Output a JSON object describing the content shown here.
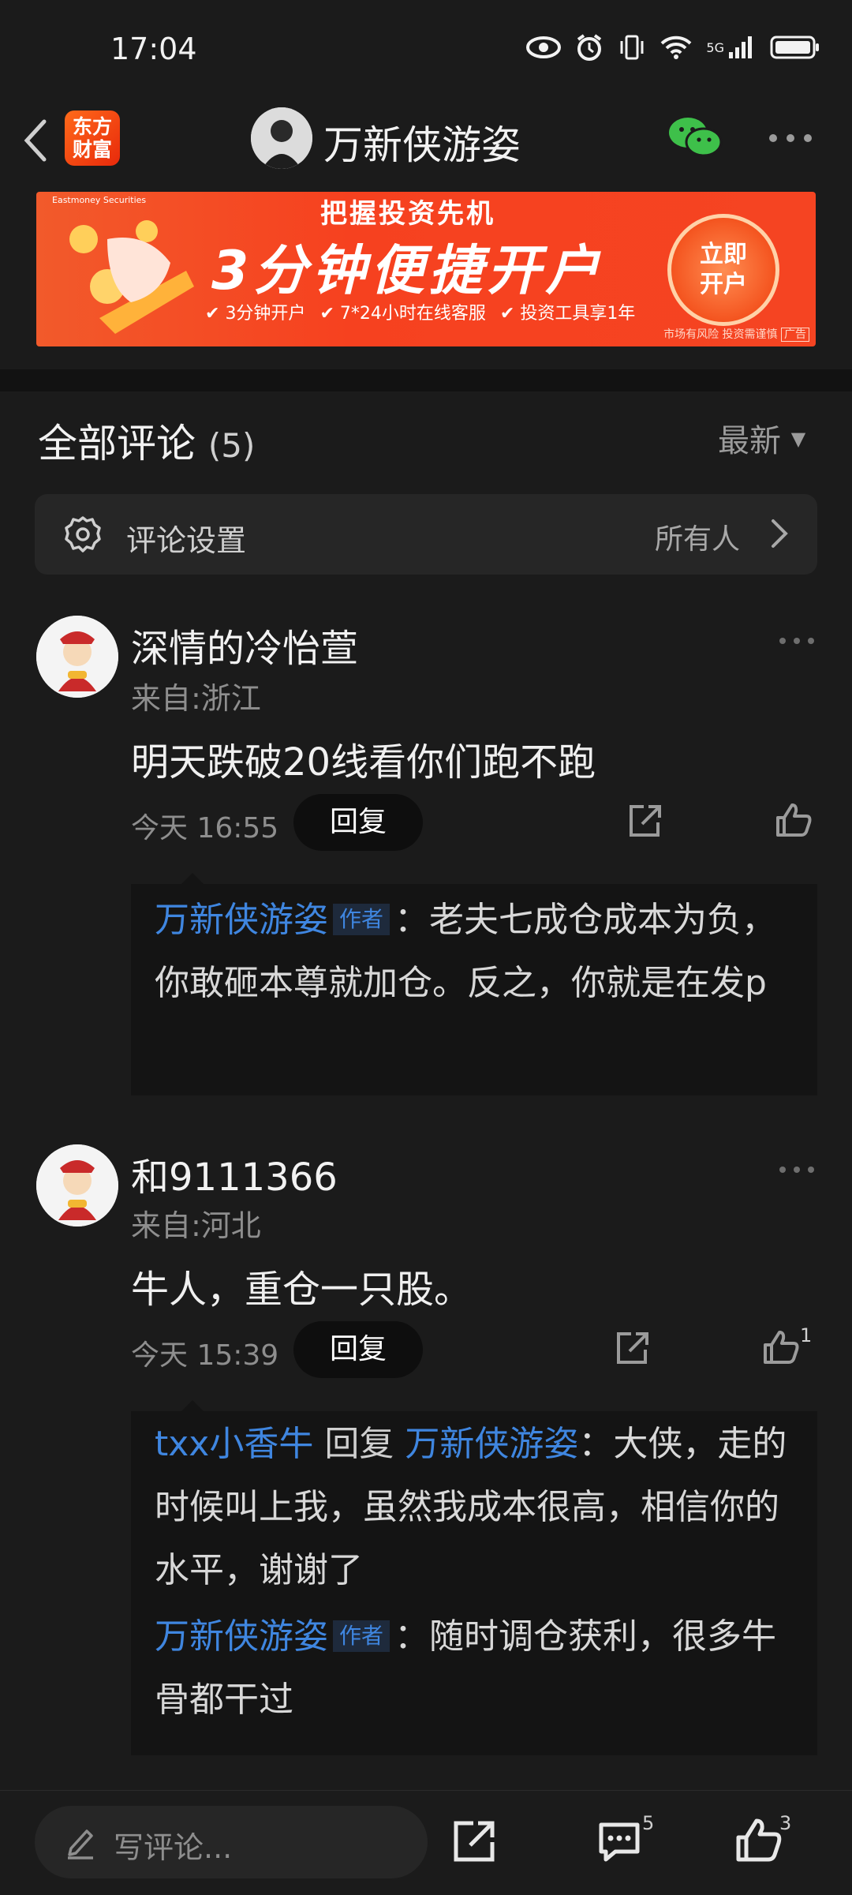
{
  "status_bar": {
    "time": "17:04",
    "network": "5G"
  },
  "header": {
    "logo_text": "东方\n财富",
    "title": "万新侠游姿"
  },
  "banner": {
    "headline": "把握投资先机",
    "main": "3分钟便捷开户",
    "features": [
      "3分钟开户",
      "7*24小时在线客服",
      "投资工具享1年"
    ],
    "button": "立即\n开户",
    "disclaimer": "市场有风险 投资需谨慎",
    "ad_label": "广告",
    "brand_small": "Eastmoney Securities"
  },
  "comments_section": {
    "title": "全部评论",
    "count": "(5)",
    "sort": "最新"
  },
  "settings": {
    "label": "评论设置",
    "value": "所有人"
  },
  "comments": [
    {
      "user": "深情的冷怡萱",
      "region": "来自:浙江",
      "text": "明天跌破20线看你们跑不跑",
      "time": "今天 16:55",
      "reply_label": "回复",
      "likes": "",
      "replies": [
        {
          "author": "万新侠游姿",
          "tag": "作者",
          "text": "：老夫七成仓成本为负，你敢砸本尊就加仓。反之，你就是在发p"
        }
      ]
    },
    {
      "user": "和9111366",
      "region": "来自:河北",
      "text": "牛人，重仓一只股。",
      "time": "今天 15:39",
      "reply_label": "回复",
      "likes": "1",
      "replies": [
        {
          "author": "txx小香牛",
          "reply_word": "回复",
          "target": "万新侠游姿",
          "text": "：大侠，走的时候叫上我，虽然我成本很高，相信你的水平，谢谢了"
        },
        {
          "author": "万新侠游姿",
          "tag": "作者",
          "text": "：随时调仓获利，很多牛骨都干过"
        }
      ]
    }
  ],
  "bottom_bar": {
    "placeholder": "写评论...",
    "comment_count": "5",
    "like_count": "3"
  }
}
